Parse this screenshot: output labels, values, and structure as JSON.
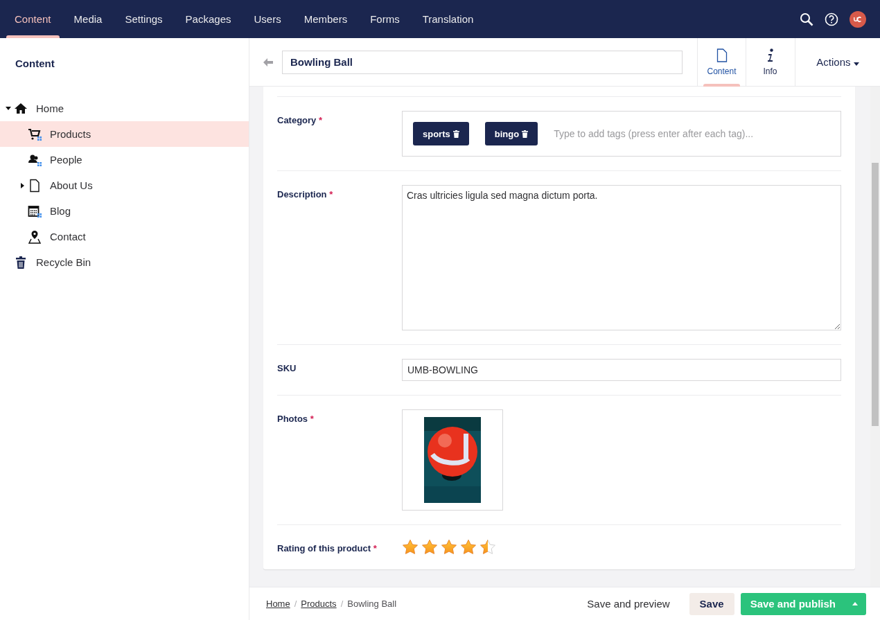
{
  "top_nav": {
    "sections": [
      {
        "label": "Content",
        "selected": true
      },
      {
        "label": "Media",
        "selected": false
      },
      {
        "label": "Settings",
        "selected": false
      },
      {
        "label": "Packages",
        "selected": false
      },
      {
        "label": "Users",
        "selected": false
      },
      {
        "label": "Members",
        "selected": false
      },
      {
        "label": "Forms",
        "selected": false
      },
      {
        "label": "Translation",
        "selected": false
      }
    ]
  },
  "sidebar": {
    "title": "Content",
    "items": [
      {
        "label": "Home",
        "kind": "home",
        "selected": false,
        "expanded": true,
        "children": [
          {
            "label": "Products",
            "kind": "cart",
            "selected": true
          },
          {
            "label": "People",
            "kind": "people",
            "selected": false
          },
          {
            "label": "About Us",
            "kind": "page",
            "selected": false,
            "expanded": false
          },
          {
            "label": "Blog",
            "kind": "calendar",
            "selected": false
          },
          {
            "label": "Contact",
            "kind": "pin",
            "selected": false
          }
        ]
      },
      {
        "label": "Recycle Bin",
        "kind": "trash",
        "selected": false
      }
    ]
  },
  "editor": {
    "name": "Bowling Ball",
    "apps": [
      {
        "label": "Content",
        "kind": "document",
        "selected": true
      },
      {
        "label": "Info",
        "kind": "info",
        "selected": false
      }
    ],
    "actions": "Actions",
    "properties": [
      {
        "kind": "tags",
        "label": "Category",
        "required_mark": "*",
        "tags": [
          "sports",
          "bingo"
        ],
        "placeholder": "Type to add tags (press enter after each tag)..."
      },
      {
        "kind": "textarea",
        "label": "Description",
        "required_mark": "*",
        "value": "Cras ultricies ligula sed magna dictum porta."
      },
      {
        "kind": "text",
        "label": "SKU",
        "value": "UMB-BOWLING"
      },
      {
        "kind": "photos",
        "label": "Photos",
        "required_mark": "*"
      },
      {
        "kind": "rating",
        "label": "Rating of this product",
        "required_mark": "*",
        "stars": 4.5
      }
    ]
  },
  "footer": {
    "breadcrumb": [
      {
        "label": "Home",
        "link": true
      },
      {
        "separator": "/",
        "label": "Products",
        "link": true
      },
      {
        "separator": "/",
        "label": "Bowling Ball",
        "link": false
      }
    ],
    "buttons": [
      {
        "label": "Save and preview",
        "kind": "link"
      },
      {
        "label": "Save",
        "kind": "secondary"
      },
      {
        "label": "Save and publish",
        "kind": "primary"
      }
    ]
  }
}
